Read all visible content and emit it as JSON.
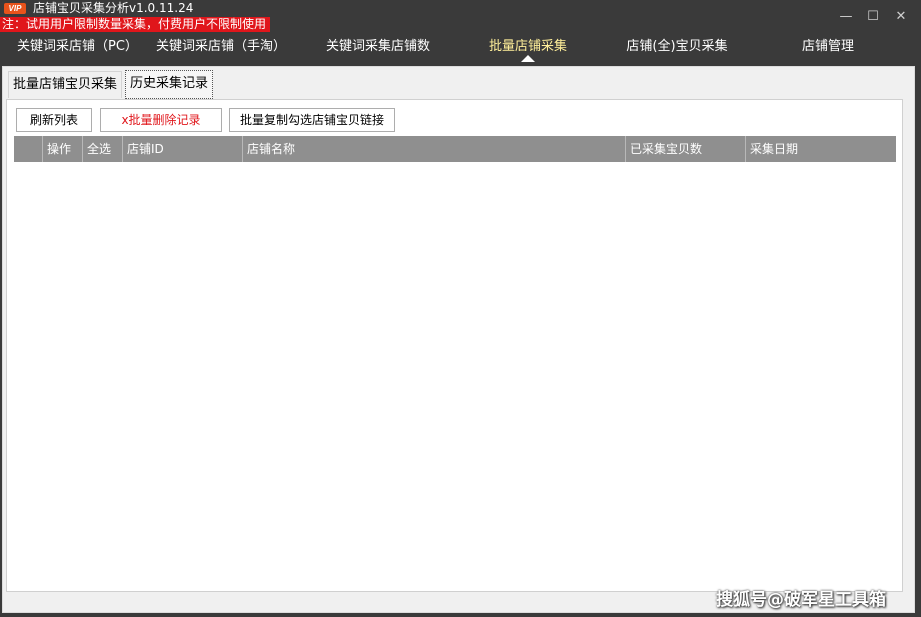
{
  "titlebar": {
    "logo_text": "VIP",
    "app_title": "店铺宝贝采集分析v1.0.11.24",
    "notice": "注：试用用户限制数量采集，付费用户不限制使用",
    "minimize_glyph": "—",
    "maximize_glyph": "☐",
    "close_glyph": "✕"
  },
  "menu": {
    "items": [
      {
        "label": "关键词采店铺（PC）"
      },
      {
        "label": "关键词采店铺（手淘）"
      },
      {
        "label": "关键词采集店铺数"
      },
      {
        "label": "批量店铺采集",
        "active": true
      },
      {
        "label": "店铺(全)宝贝采集"
      },
      {
        "label": "店铺管理"
      }
    ],
    "active_color": "#ffef9a"
  },
  "subtabs": [
    {
      "label": "批量店铺宝贝采集"
    },
    {
      "label": "历史采集记录",
      "active": true
    }
  ],
  "toolbar": {
    "refresh_label": "刷新列表",
    "batch_delete_label": "x批量删除记录",
    "copy_links_label": "批量复制勾选店铺宝贝链接"
  },
  "table": {
    "columns": [
      "",
      "操作",
      "全选",
      "店铺ID",
      "店铺名称",
      "已采集宝贝数",
      "采集日期"
    ],
    "rows": []
  },
  "watermark": "搜狐号@破军星工具箱",
  "colors": {
    "background": "#3a3a3a",
    "notice": "#e0161b",
    "header": "#8f8f8f",
    "logo": "#e8531b"
  }
}
